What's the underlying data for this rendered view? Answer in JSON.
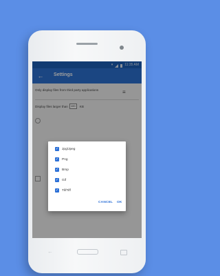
{
  "status_bar": {
    "time": "11:35 AM"
  },
  "app_bar": {
    "back_icon": "arrow-back-icon",
    "title": "Settings"
  },
  "settings": {
    "pref_only_display": "Only display files from third party applications",
    "pref_display_larger": "Display files larger than",
    "size_value": "100",
    "size_unit": "KB",
    "tune_icon": "tune-icon"
  },
  "dialog": {
    "options": [
      {
        "label": "Jpg/Jpeg",
        "checked": true
      },
      {
        "label": "Png",
        "checked": true
      },
      {
        "label": "Bmp",
        "checked": true
      },
      {
        "label": "Gif",
        "checked": true
      },
      {
        "label": "Tif/Tiff",
        "checked": true
      }
    ],
    "cancel_label": "CANCEL",
    "ok_label": "OK"
  },
  "colors": {
    "background": "#5b8ee6",
    "status_bar": "#1c5fb8",
    "app_bar": "#2d72d2",
    "accent": "#2b6fd6"
  }
}
